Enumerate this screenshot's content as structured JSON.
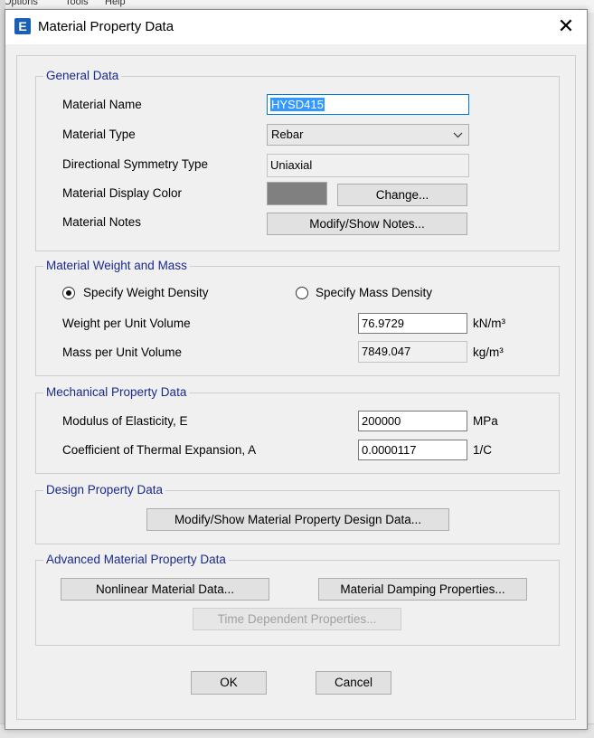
{
  "background": {
    "menu_fragments": [
      "Options",
      "Tools",
      "Help"
    ]
  },
  "dialog": {
    "icon_letter": "E",
    "title": "Material Property Data",
    "close_glyph": "✕"
  },
  "general": {
    "title": "General Data",
    "material_name_label": "Material Name",
    "material_name_value": "HYSD415",
    "material_type_label": "Material Type",
    "material_type_value": "Rebar",
    "symmetry_label": "Directional Symmetry Type",
    "symmetry_value": "Uniaxial",
    "display_color_label": "Material Display Color",
    "display_color": "#808080",
    "change_label": "Change...",
    "notes_label": "Material Notes",
    "notes_button": "Modify/Show Notes..."
  },
  "weight": {
    "title": "Material Weight and Mass",
    "weight_density_radio": "Specify Weight Density",
    "mass_density_radio": "Specify Mass Density",
    "selected": "weight",
    "weight_label": "Weight per Unit Volume",
    "weight_value": "76.9729",
    "weight_unit": "kN/m³",
    "mass_label": "Mass per Unit Volume",
    "mass_value": "7849.047",
    "mass_unit": "kg/m³"
  },
  "mechanical": {
    "title": "Mechanical Property Data",
    "modulus_label": "Modulus of Elasticity,  E",
    "modulus_value": "200000",
    "modulus_unit": "MPa",
    "thermal_label": "Coefficient of Thermal Expansion,  A",
    "thermal_value": "0.0000117",
    "thermal_unit": "1/C"
  },
  "design": {
    "title": "Design Property Data",
    "button": "Modify/Show Material Property Design Data..."
  },
  "advanced": {
    "title": "Advanced Material Property Data",
    "nonlinear_button": "Nonlinear Material Data...",
    "damping_button": "Material Damping Properties...",
    "time_button": "Time Dependent Properties..."
  },
  "footer": {
    "ok": "OK",
    "cancel": "Cancel"
  }
}
